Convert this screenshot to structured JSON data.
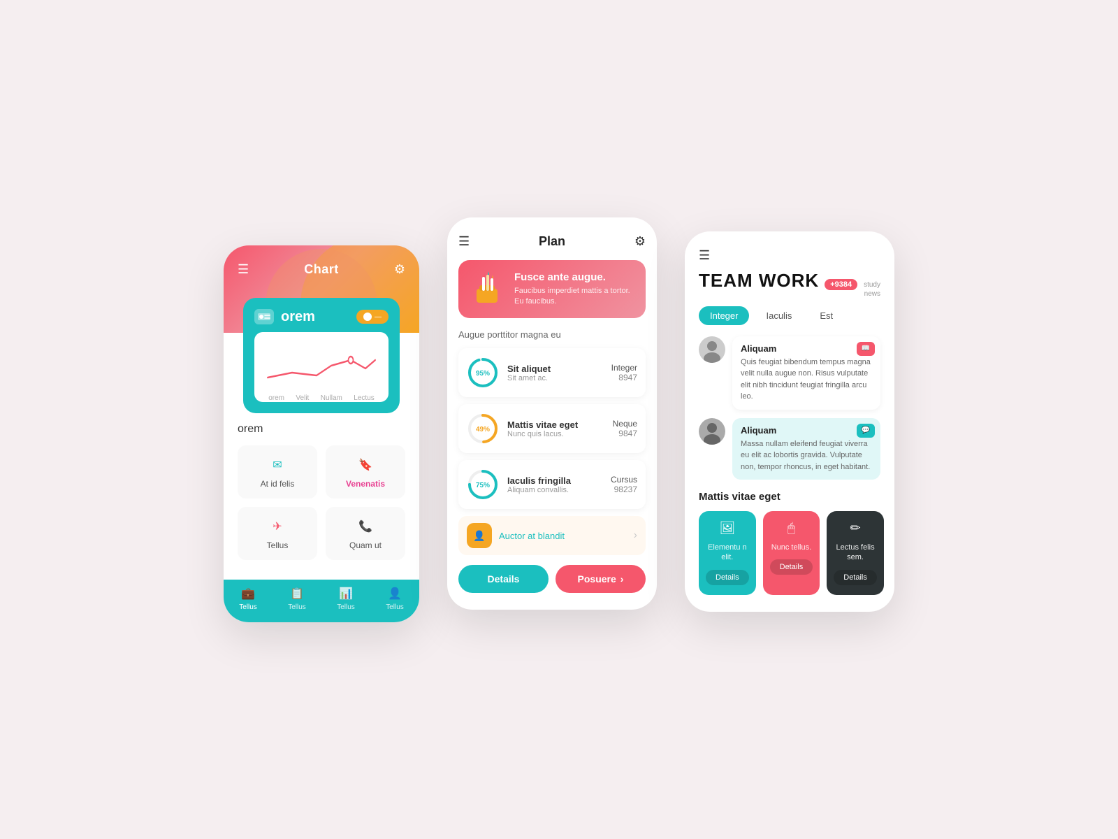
{
  "screen1": {
    "title": "Chart",
    "card_name": "orem",
    "chart_labels": [
      "orem",
      "Velit",
      "Nullam",
      "Lectus"
    ],
    "section_title": "orem",
    "menu_items": [
      {
        "label": "At id felis",
        "bold": false,
        "icon": "✉"
      },
      {
        "label": "Venenatis",
        "bold": true,
        "icon": "🔖"
      },
      {
        "label": "Tellus",
        "bold": false,
        "icon": "✈"
      },
      {
        "label": "Quam ut",
        "bold": false,
        "icon": "📞"
      }
    ],
    "nav_items": [
      {
        "label": "Tellus",
        "active": true
      },
      {
        "label": "Tellus",
        "active": false
      },
      {
        "label": "Tellus",
        "active": false
      },
      {
        "label": "Tellus",
        "active": false
      }
    ]
  },
  "screen2": {
    "title": "Plan",
    "hero": {
      "heading": "Fusce ante augue.",
      "body": "Faucibus imperdiet mattis a tortor. Eu faucibus."
    },
    "section_label": "Augue porttitor magna eu",
    "items": [
      {
        "percent": 95,
        "name": "Sit aliquet",
        "sub": "Sit amet ac.",
        "cat": "Integer",
        "num": "8947",
        "color": "#1bbfbf"
      },
      {
        "percent": 49,
        "name": "Mattis vitae eget",
        "sub": "Nunc quis lacus.",
        "cat": "Neque",
        "num": "9847",
        "color": "#f5a623"
      },
      {
        "percent": 75,
        "name": "Iaculis fringilla",
        "sub": "Aliquam convallis.",
        "cat": "Cursus",
        "num": "98237",
        "color": "#1bbfbf"
      }
    ],
    "footer_link": "Auctor at blandit",
    "btn_details": "Details",
    "btn_posuere": "Posuere"
  },
  "screen3": {
    "title": "TEAM WORK",
    "badge": "+9384",
    "tag1": "study",
    "tag2": "news",
    "tabs": [
      "Integer",
      "Iaculis",
      "Est"
    ],
    "active_tab": 0,
    "messages": [
      {
        "name": "Aliquam",
        "text": "Quis feugiat bibendum tempus magna velit nulla augue non. Risus vulputate elit nibh tincidunt feugiat fringilla arcu leo.",
        "icon_type": "book"
      },
      {
        "name": "Aliquam",
        "text": "Massa nullam eleifend feugiat viverra eu elit ac lobortis gravida. Vulputate non, tempor rhoncus, in eget habitant.",
        "icon_type": "chat"
      }
    ],
    "section_title": "Mattis vitae eget",
    "cards": [
      {
        "icon": "🖼",
        "label": "Elementu n elit.",
        "btn": "Details",
        "bg": "teal"
      },
      {
        "icon": "🖱",
        "label": "Nunc tellus.",
        "btn": "Details",
        "bg": "pink"
      },
      {
        "icon": "✏",
        "label": "Lectus felis sem.",
        "btn": "Details",
        "bg": "dark"
      }
    ]
  }
}
